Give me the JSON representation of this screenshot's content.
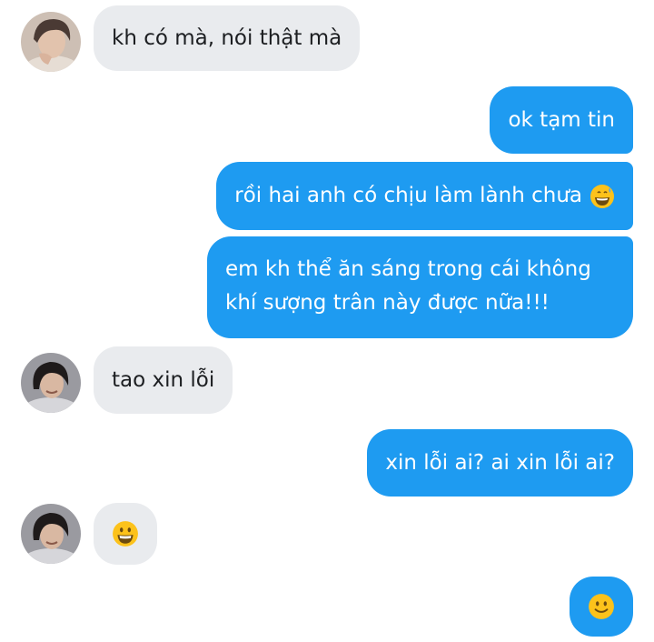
{
  "messages": [
    {
      "sender": "contact-1",
      "text": "kh có mà, nói thật mà"
    },
    {
      "sender": "me",
      "text": "ok tạm tin"
    },
    {
      "sender": "me",
      "text": "rồi hai anh có chịu làm lành chưa",
      "emoji": "grinning-sweat-emoji"
    },
    {
      "sender": "me",
      "lines": [
        "em kh thể ăn sáng trong cái không",
        "khí sượng trân này được nữa!!!"
      ]
    },
    {
      "sender": "contact-2",
      "text": "tao xin lỗi"
    },
    {
      "sender": "me",
      "text": "xin lỗi ai? ai xin lỗi ai?"
    },
    {
      "sender": "contact-2",
      "emoji": "grinning-emoji"
    },
    {
      "sender": "me",
      "emoji": "slight-smile-emoji"
    }
  ],
  "colors": {
    "incoming_bubble": "#e9ebee",
    "outgoing_bubble": "#1e9bf1",
    "incoming_text": "#1c1e21",
    "outgoing_text": "#ffffff"
  }
}
